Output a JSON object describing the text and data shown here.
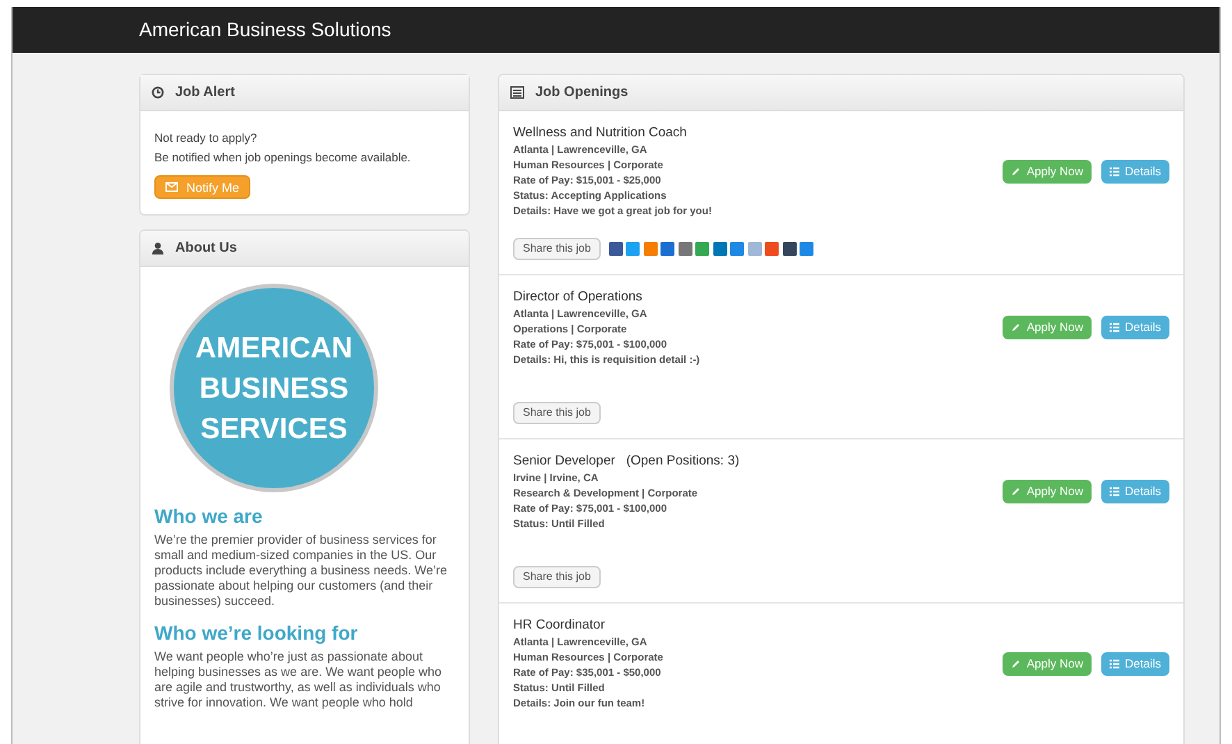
{
  "header": {
    "title": "American Business Solutions"
  },
  "job_alert": {
    "title": "Job Alert",
    "lines": [
      "Not ready to apply?",
      "Be notified when job openings become available."
    ],
    "button": "Notify Me"
  },
  "about": {
    "title": "About Us",
    "logo_lines": [
      "AMERICAN",
      "BUSINESS",
      "SERVICES"
    ],
    "sections": [
      {
        "heading": "Who we are",
        "text": "We’re the premier provider of business services for small and medium-sized companies in the US. Our products include everything a business needs. We’re passionate about helping our customers (and their businesses) succeed."
      },
      {
        "heading": "Who we’re looking for",
        "text": "We want people who’re just as passionate about helping businesses as we are. We want people who are agile and trustworthy, as well as individuals who strive for innovation. We want people who hold"
      }
    ]
  },
  "job_openings": {
    "title": "Job Openings",
    "jobs": [
      {
        "title": "Wellness and Nutrition Coach",
        "lines": [
          "Atlanta | Lawrenceville, GA",
          "Human Resources | Corporate",
          "Rate of Pay: $15,001 - $25,000",
          "Status: Accepting Applications",
          "Details: Have we got a great job for you!"
        ],
        "apply_label": "Apply Now",
        "details_label": "Details",
        "share_label": "Share this job",
        "social_icons": true
      },
      {
        "title": "Director of Operations",
        "lines": [
          "Atlanta | Lawrenceville, GA",
          "Operations | Corporate",
          "Rate of Pay: $75,001 - $100,000",
          "Details: Hi, this is requisition detail :-)"
        ],
        "apply_label": "Apply Now",
        "details_label": "Details",
        "share_label": "Share this job",
        "social_icons": false
      },
      {
        "title": "Senior Developer   (Open Positions: 3)",
        "lines": [
          "Irvine | Irvine, CA",
          "Research & Development | Corporate",
          "Rate of Pay: $75,001 - $100,000",
          "Status: Until Filled"
        ],
        "apply_label": "Apply Now",
        "details_label": "Details",
        "share_label": "Share this job",
        "social_icons": false
      },
      {
        "title": "HR Coordinator",
        "lines": [
          "Atlanta | Lawrenceville, GA",
          "Human Resources | Corporate",
          "Rate of Pay: $35,001 - $50,000",
          "Status: Until Filled",
          "Details: Join our fun team!"
        ],
        "apply_label": "Apply Now",
        "details_label": "Details"
      }
    ]
  }
}
